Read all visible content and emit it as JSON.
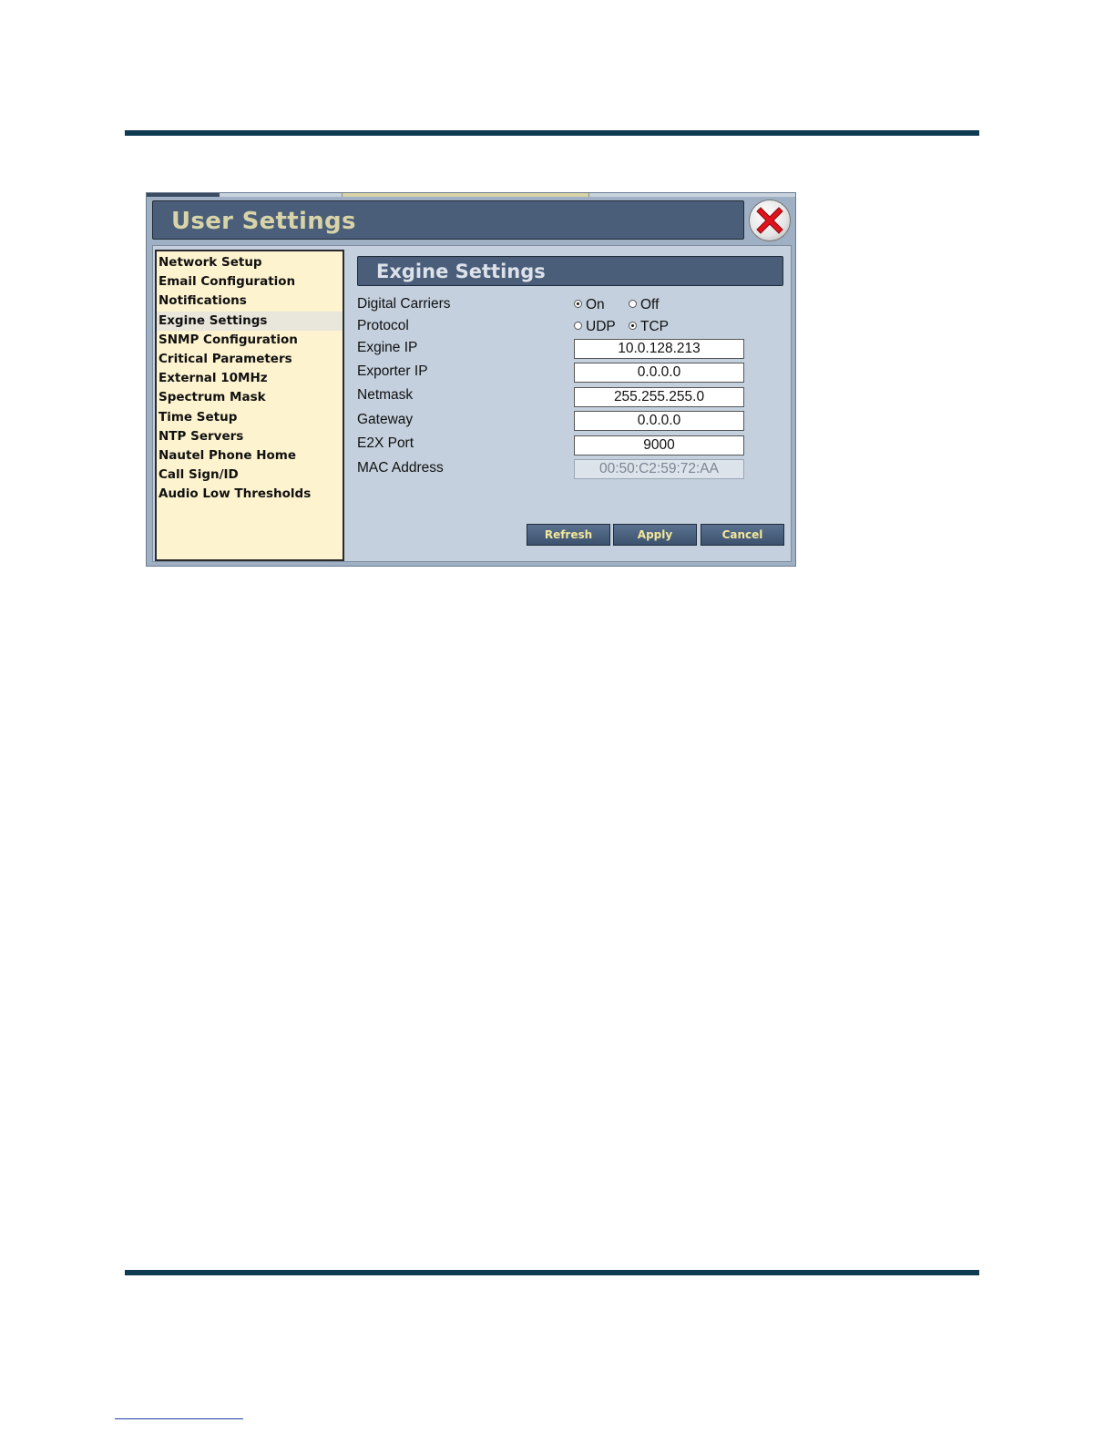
{
  "window": {
    "title": "User Settings"
  },
  "sidebar": {
    "items": [
      {
        "label": "Network Setup",
        "active": false
      },
      {
        "label": "Email Configuration",
        "active": false
      },
      {
        "label": "Notifications",
        "active": false
      },
      {
        "label": "Exgine Settings",
        "active": true
      },
      {
        "label": "SNMP Configuration",
        "active": false
      },
      {
        "label": "Critical Parameters",
        "active": false
      },
      {
        "label": "External 10MHz",
        "active": false
      },
      {
        "label": "Spectrum Mask",
        "active": false
      },
      {
        "label": "Time Setup",
        "active": false
      },
      {
        "label": "NTP Servers",
        "active": false
      },
      {
        "label": "Nautel Phone Home",
        "active": false
      },
      {
        "label": "Call Sign/ID",
        "active": false
      },
      {
        "label": "Audio Low Thresholds",
        "active": false
      }
    ]
  },
  "panel": {
    "title": "Exgine Settings",
    "digital_carriers": {
      "label": "Digital Carriers",
      "options": [
        "On",
        "Off"
      ],
      "selected": "On"
    },
    "protocol": {
      "label": "Protocol",
      "options": [
        "UDP",
        "TCP"
      ],
      "selected": "TCP"
    },
    "exgine_ip": {
      "label": "Exgine IP",
      "value": "10.0.128.213"
    },
    "exporter_ip": {
      "label": "Exporter IP",
      "value": "0.0.0.0"
    },
    "netmask": {
      "label": "Netmask",
      "value": "255.255.255.0"
    },
    "gateway": {
      "label": "Gateway",
      "value": "0.0.0.0"
    },
    "e2x_port": {
      "label": "E2X Port",
      "value": "9000"
    },
    "mac_address": {
      "label": "MAC Address",
      "value": "00:50:C2:59:72:AA"
    }
  },
  "buttons": {
    "refresh": "Refresh",
    "apply": "Apply",
    "cancel": "Cancel"
  },
  "colors": {
    "title_bar": "#4a5e7a",
    "sidebar_bg": "#fdf3cf",
    "button_text": "#f3e79a",
    "rule": "#0e3a52"
  }
}
